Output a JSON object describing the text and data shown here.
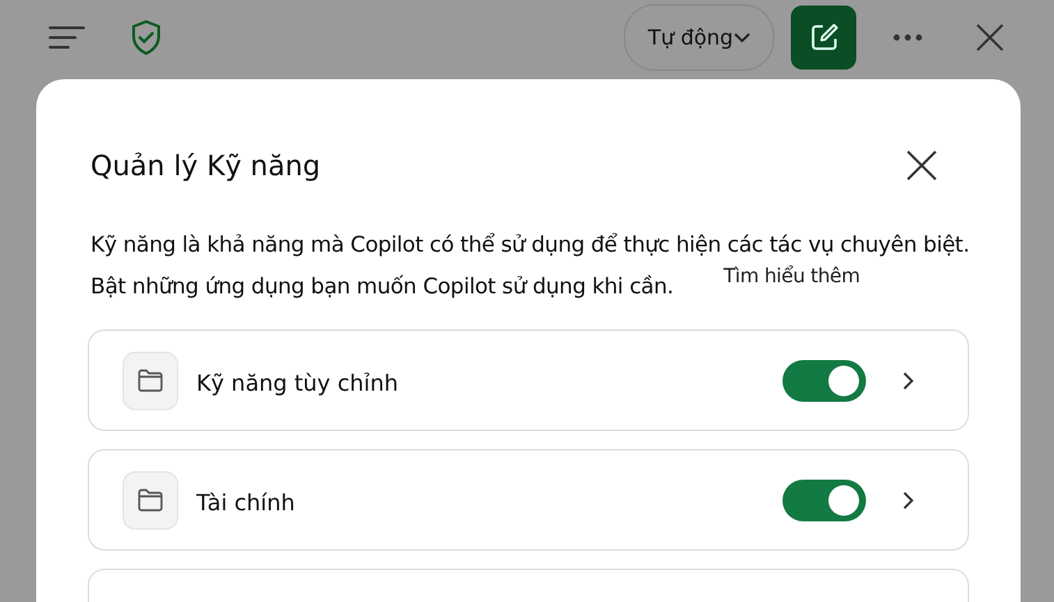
{
  "top_bar": {
    "mode_dropdown": "Tự động"
  },
  "dialog": {
    "title": "Quản lý Kỹ năng",
    "description": [
      "Kỹ năng là khả năng mà Copilot có thể sử dụng để thực hiện các tác vụ chuyên biệt.",
      "Bật những ứng dụng bạn muốn Copilot sử dụng khi cần."
    ],
    "learn_more": "Tìm hiểu thêm",
    "skills": [
      {
        "name": "Kỹ năng tùy chỉnh",
        "on": true
      },
      {
        "name": "Tài chính",
        "on": true
      }
    ]
  }
}
